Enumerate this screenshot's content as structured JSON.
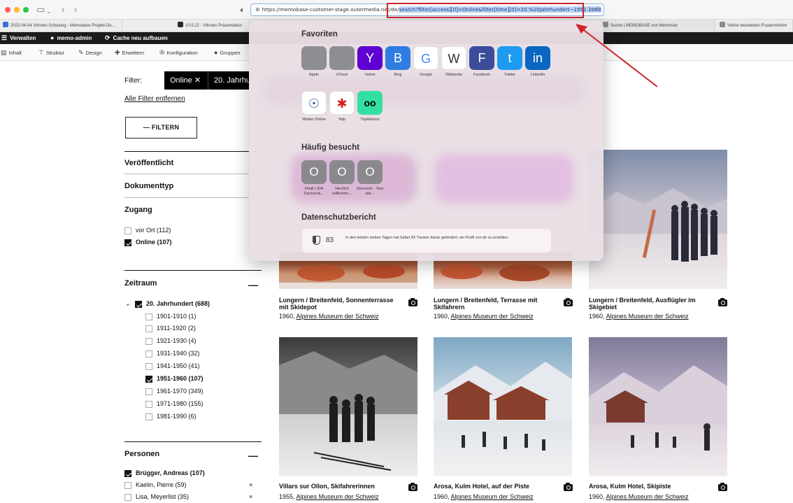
{
  "browser": {
    "url_prefix": "https://memobase-customer-stage.outermedia.net/de/",
    "url_selected": "search?filter[access][0]=Online&filter[time][0]=20.%20Jahrhundert~1951-1960"
  },
  "tabs": [
    {
      "label": "2022-04-04 Vitrinen-Schulung - Memobase Projekt-Do...",
      "color": "#3b6fd6"
    },
    {
      "label": "10.5.22 - Vitrinen Präsentation",
      "color": "#2a2a2a"
    },
    {
      "label": "Suche | MEMOBASE von Memoriav",
      "color": "#8a8a8a"
    },
    {
      "label": "Vitrine bearbeiten Frauenstimmr",
      "color": "#8a8a8a"
    }
  ],
  "admin_bar": {
    "items": [
      "Verwalten",
      "memo-admin",
      "Cache neu aufbauen"
    ]
  },
  "sub_nav": {
    "items": [
      "Inhalt",
      "Struktur",
      "Design",
      "Erweitern",
      "Konfiguration",
      "Gruppen"
    ]
  },
  "filters": {
    "label": "Filter:",
    "chips": [
      "Online ✕",
      "20. Jahrhun"
    ],
    "remove_all": "Alle Filter entfernen",
    "filtern_button": "— FILTERN"
  },
  "facets": {
    "veroeffentlicht": "Veröffentlicht",
    "dokumenttyp": "Dokumenttyp",
    "zugang": {
      "title": "Zugang",
      "options": [
        {
          "label": "vor Ort (112)",
          "checked": false
        },
        {
          "label": "Online (107)",
          "checked": true
        }
      ]
    },
    "zeitraum": {
      "title": "Zeitraum",
      "toggle": "—",
      "parent": {
        "label": "20. Jahrhundert (688)",
        "checked": true
      },
      "options": [
        {
          "label": "1901-1910 (1)",
          "checked": false
        },
        {
          "label": "1911-1920 (2)",
          "checked": false
        },
        {
          "label": "1921-1930 (4)",
          "checked": false
        },
        {
          "label": "1931-1940 (32)",
          "checked": false
        },
        {
          "label": "1941-1950 (41)",
          "checked": false
        },
        {
          "label": "1951-1960 (107)",
          "checked": true
        },
        {
          "label": "1961-1970 (349)",
          "checked": false
        },
        {
          "label": "1971-1980 (155)",
          "checked": false
        },
        {
          "label": "1981-1990 (6)",
          "checked": false
        }
      ]
    },
    "personen": {
      "title": "Personen",
      "toggle": "—",
      "options": [
        {
          "label": "Brügger, Andreas (107)",
          "checked": true,
          "remove": ""
        },
        {
          "label": "Kaelin, Pierre (59)",
          "checked": false,
          "remove": "×"
        },
        {
          "label": "Lisa, Meyerlist (35)",
          "checked": false,
          "remove": "×"
        }
      ]
    }
  },
  "results": [
    {
      "title": "Lungern / Breitenfeld, Sonnenterrasse mit Skidepot",
      "year": "1960,",
      "source": "Alpines Museum der Schweiz"
    },
    {
      "title": "Lungern / Breitenfeld, Terrasse mit Skifahrern",
      "year": "1960,",
      "source": "Alpines Museum der Schweiz"
    },
    {
      "title": "Lungern / Breitenfeld, Ausflügler im Skigebiet",
      "year": "1960,",
      "source": "Alpines Museum der Schweiz"
    },
    {
      "title": "Villars sur Ollon, Skifahrerinnen",
      "year": "1955,",
      "source": "Alpines Museum der Schweiz"
    },
    {
      "title": "Arosa, Kulm Hotel, auf der Piste",
      "year": "1960,",
      "source": "Alpines Museum der Schweiz"
    },
    {
      "title": "Arosa, Kulm Hotel, Skipiste",
      "year": "1960,",
      "source": "Alpines Museum der Schweiz"
    }
  ],
  "favorites_popup": {
    "favoriten_title": "Favoriten",
    "favorites": [
      {
        "label": "Apple",
        "glyph": "",
        "bg": "#8d8d92"
      },
      {
        "label": "iCloud",
        "glyph": "",
        "bg": "#8d8d92"
      },
      {
        "label": "Yahoo",
        "glyph": "Y",
        "bg": "#5f01d1"
      },
      {
        "label": "Bing",
        "glyph": "B",
        "bg": "#2f7de1"
      },
      {
        "label": "Google",
        "glyph": "G",
        "bg": "#ffffff"
      },
      {
        "label": "Wikipedia",
        "glyph": "W",
        "bg": "#ffffff"
      },
      {
        "label": "Facebook",
        "glyph": "F",
        "bg": "#3b4d9a"
      },
      {
        "label": "Twitter",
        "glyph": "t",
        "bg": "#1d9bf0"
      },
      {
        "label": "LinkedIn",
        "glyph": "in",
        "bg": "#0a66c2"
      }
    ],
    "favorites_row2": [
      {
        "label": "Wetter Online",
        "glyph": "☉",
        "bg": "#ffffff"
      },
      {
        "label": "Yelp",
        "glyph": "✱",
        "bg": "#ffffff"
      },
      {
        "label": "TripAdvisor",
        "glyph": "oo",
        "bg": "#34e0a1"
      }
    ],
    "frequent_title": "Häufig besucht",
    "frequent": [
      {
        "label": "Inhalt | IDA Dachverb...",
        "glyph": "O"
      },
      {
        "label": "Herzlich willkomm...",
        "glyph": "O"
      },
      {
        "label": "Übersicht - Your site...",
        "glyph": "O"
      }
    ],
    "privacy_title": "Datenschutzbericht",
    "privacy_count": "83",
    "privacy_text": "In den letzten sieben Tagen hat Safari 83 Tracker daran gehindert, ein Profil von dir zu erstellen."
  },
  "colors": {
    "highlight_red": "#d0252b",
    "text": "#111111"
  }
}
